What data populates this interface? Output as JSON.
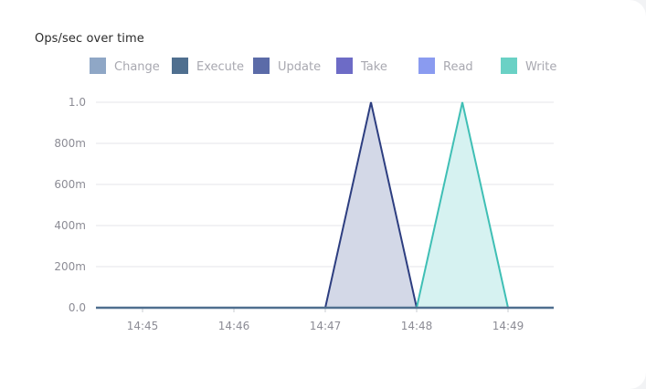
{
  "panel": {
    "title": "Ops/sec over time"
  },
  "chart_data": {
    "type": "area",
    "title": "Ops/sec over time",
    "xlabel": "",
    "ylabel": "",
    "x_ticks": [
      "14:45",
      "14:46",
      "14:47",
      "14:48",
      "14:49"
    ],
    "y_ticks": [
      "0.0",
      "200m",
      "400m",
      "600m",
      "800m",
      "1.0"
    ],
    "ylim": [
      0,
      1
    ],
    "grid": true,
    "legend_position": "top",
    "x": [
      "14:44.5",
      "14:45",
      "14:46",
      "14:47",
      "14:47.5",
      "14:48",
      "14:48.5",
      "14:49",
      "14:49.5"
    ],
    "series": [
      {
        "name": "Change",
        "color": "#8fa7c6",
        "fill": false,
        "values": [
          0,
          0,
          0,
          0,
          0,
          0,
          0,
          0,
          0
        ]
      },
      {
        "name": "Execute",
        "color": "#4f6f8f",
        "fill": false,
        "values": [
          0,
          0,
          0,
          0,
          0,
          0,
          0,
          0,
          0
        ]
      },
      {
        "name": "Update",
        "color": "#5b6ba8",
        "fill": false,
        "values": [
          0,
          0,
          0,
          0,
          0,
          0,
          0,
          0,
          0
        ]
      },
      {
        "name": "Take",
        "color": "#6d6bc6",
        "fill": true,
        "fill_color": "#d3d8e7",
        "line_color": "#2d3e80",
        "values": [
          0,
          0,
          0,
          0,
          1,
          0,
          0,
          0,
          0
        ]
      },
      {
        "name": "Read",
        "color": "#8a9bf0",
        "fill": false,
        "values": [
          0,
          0,
          0,
          0,
          0,
          0,
          0,
          0,
          0
        ]
      },
      {
        "name": "Write",
        "color": "#6ad1c5",
        "fill": true,
        "fill_color": "#d6f2f1",
        "line_color": "#3fbfb5",
        "values": [
          0,
          0,
          0,
          0,
          0,
          0,
          1,
          0,
          0
        ]
      }
    ]
  }
}
